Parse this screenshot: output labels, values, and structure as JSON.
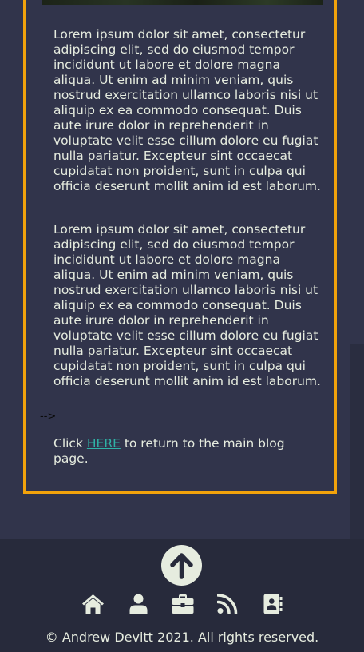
{
  "article": {
    "paragraphs": [
      "Lorem ipsum dolor sit amet, consectetur adipiscing elit, sed do eiusmod tempor incididunt ut labore et dolore magna aliqua. Ut enim ad minim veniam, quis nostrud exercitation ullamco laboris nisi ut aliquip ex ea commodo consequat. Duis aute irure dolor in reprehenderit in voluptate velit esse cillum dolore eu fugiat nulla pariatur. Excepteur sint occaecat cupidatat non proident, sunt in culpa qui officia deserunt mollit anim id est laborum.",
      "Lorem ipsum dolor sit amet, consectetur adipiscing elit, sed do eiusmod tempor incididunt ut labore et dolore magna aliqua. Ut enim ad minim veniam, quis nostrud exercitation ullamco laboris nisi ut aliquip ex ea commodo consequat. Duis aute irure dolor in reprehenderit in voluptate velit esse cillum dolore eu fugiat nulla pariatur. Excepteur sint occaecat cupidatat non proident, sunt in culpa qui officia deserunt mollit anim id est laborum."
    ],
    "stray_text": "-->",
    "return_prefix": "Click ",
    "return_link": "HERE",
    "return_suffix": " to return to the main blog page."
  },
  "footer": {
    "back_to_top_icon": "arrow-up-icon",
    "icons": [
      "home-icon",
      "user-icon",
      "briefcase-icon",
      "rss-icon",
      "address-book-icon"
    ],
    "copyright": "© Andrew Devitt 2021. All rights reserved."
  },
  "colors": {
    "background": "#31344b",
    "footer_background": "#272a3b",
    "card_border": "#f2a20b",
    "text": "#e6ecdf",
    "link": "#2fb2a6"
  }
}
